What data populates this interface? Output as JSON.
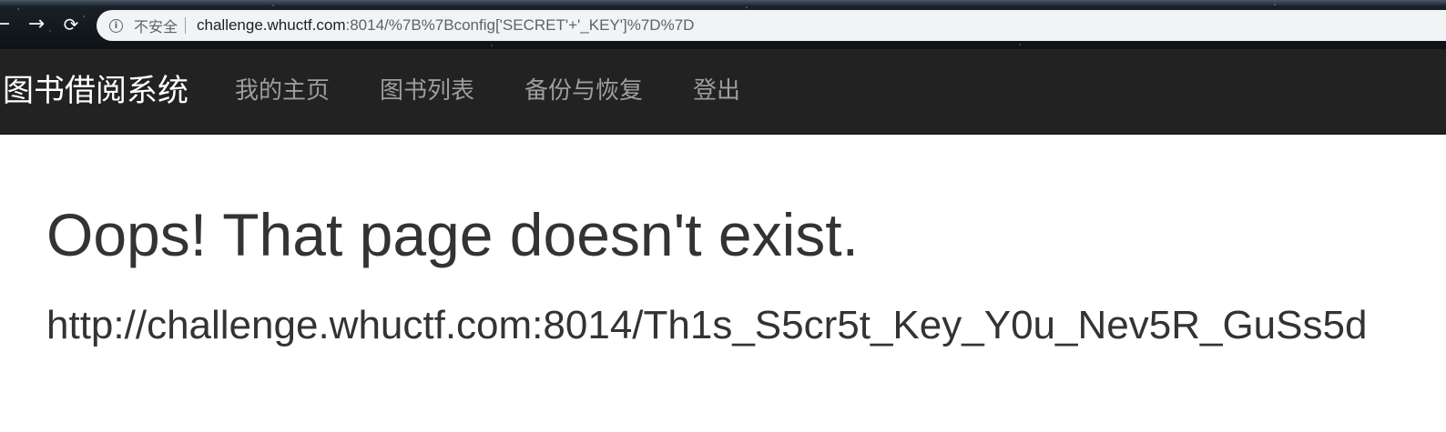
{
  "browser": {
    "back_glyph": "←",
    "forward_glyph": "→",
    "reload_glyph": "⟳",
    "security_icon": "info-icon",
    "security_icon_glyph": "i",
    "security_label": "不安全",
    "url_host": "challenge.whuctf.com",
    "url_rest": ":8014/%7B%7Bconfig['SECRET'+'_KEY']%7D%7D"
  },
  "navbar": {
    "brand": "图书借阅系统",
    "links": [
      {
        "label": "我的主页"
      },
      {
        "label": "图书列表"
      },
      {
        "label": "备份与恢复"
      },
      {
        "label": "登出"
      }
    ]
  },
  "main": {
    "heading": "Oops! That page doesn't exist.",
    "requested_url": "http://challenge.whuctf.com:8014/Th1s_S5cr5t_Key_Y0u_Nev5R_GuSs5d"
  },
  "colors": {
    "navbar_bg": "#222222",
    "brand_text": "#ffffff",
    "nav_link_text": "#9d9d9d",
    "body_text": "#333333"
  }
}
